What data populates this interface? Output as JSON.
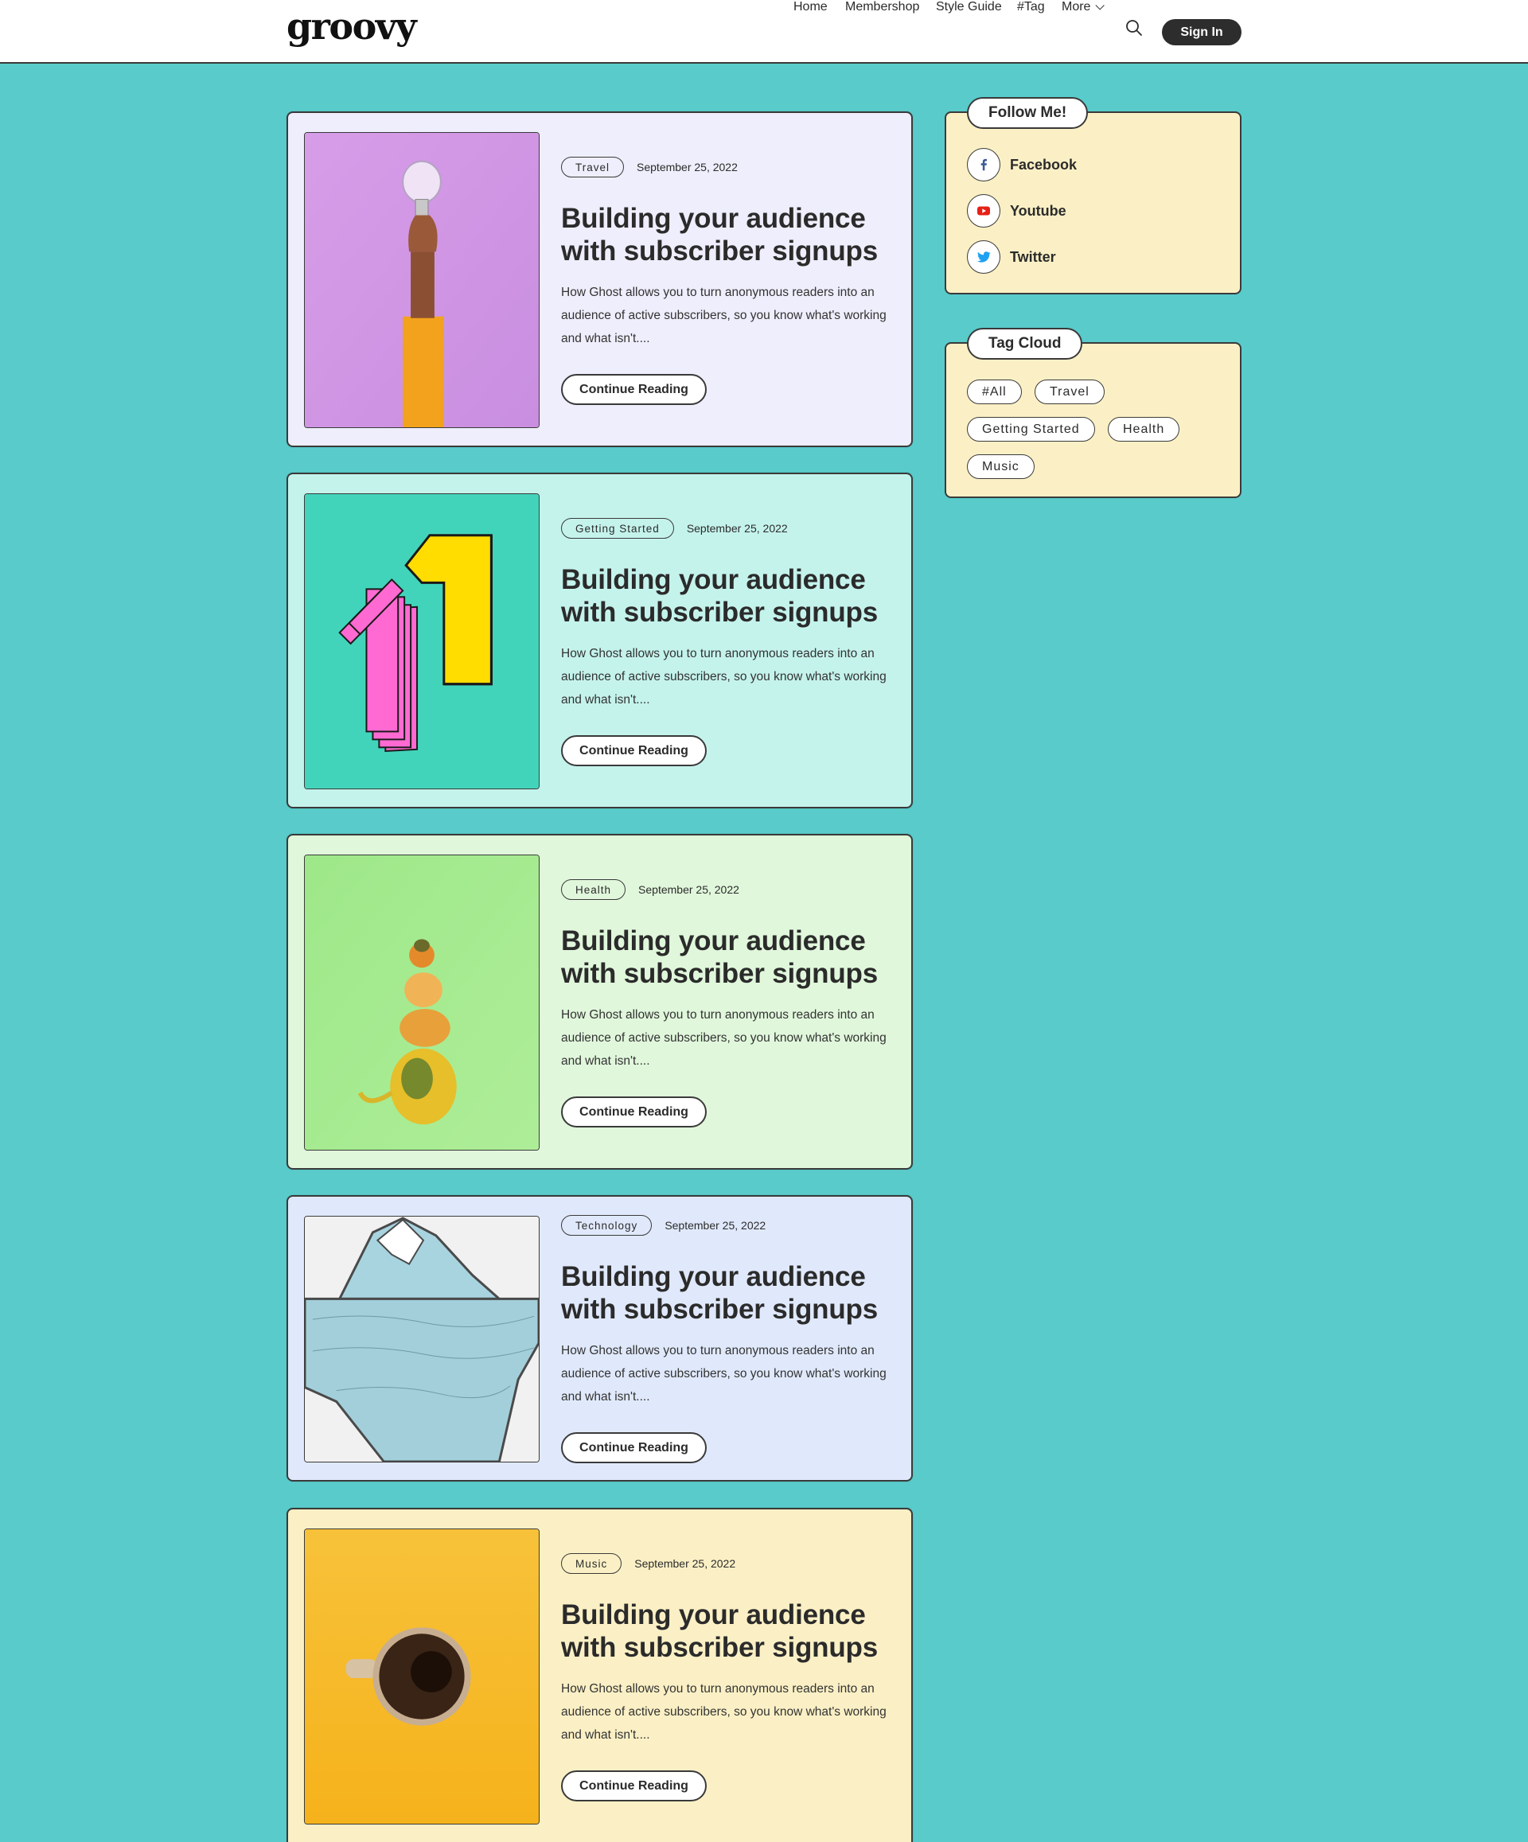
{
  "header": {
    "logo": "groovy",
    "nav": [
      {
        "label": "Home"
      },
      {
        "label": "Membershop"
      },
      {
        "label": "Style Guide"
      },
      {
        "label": "#Tag"
      },
      {
        "label": "More"
      }
    ],
    "search_icon": "search-icon",
    "signin_label": "Sign In"
  },
  "posts": [
    {
      "tag": "Travel",
      "date": "September 25, 2022",
      "title": "Building your audience with subscriber signups",
      "excerpt": "How Ghost allows you to turn anonymous readers into an audience of active subscribers, so you know what's working and what isn't....",
      "button": "Continue Reading",
      "bg": "#eeeefc",
      "image": "lightbulb-in-hand"
    },
    {
      "tag": "Getting Started",
      "date": "September 25, 2022",
      "title": "Building your audience with subscriber signups",
      "excerpt": "How Ghost allows you to turn anonymous readers into an audience of active subscribers, so you know what's working and what isn't....",
      "button": "Continue Reading",
      "bg": "#c4f3ec",
      "image": "number-one-illustration"
    },
    {
      "tag": "Health",
      "date": "September 25, 2022",
      "title": "Building your audience with subscriber signups",
      "excerpt": "How Ghost allows you to turn anonymous readers into an audience of active subscribers, so you know what's working and what isn't....",
      "button": "Continue Reading",
      "bg": "#e0f7db",
      "image": "stacked-gourds"
    },
    {
      "tag": "Technology",
      "date": "September 25, 2022",
      "title": "Building your audience with subscriber signups",
      "excerpt": "How Ghost allows you to turn anonymous readers into an audience of active subscribers, so you know what's working and what isn't....",
      "button": "Continue Reading",
      "bg": "#e0e9fb",
      "image": "iceberg-illustration"
    },
    {
      "tag": "Music",
      "date": "September 25, 2022",
      "title": "Building your audience with subscriber signups",
      "excerpt": "How Ghost allows you to turn anonymous readers into an audience of active subscribers, so you know what's working and what isn't....",
      "button": "Continue Reading",
      "bg": "#fbf0c5",
      "image": "coffee-cup"
    }
  ],
  "sidebar": {
    "follow": {
      "title": "Follow Me!",
      "items": [
        {
          "label": "Facebook",
          "icon": "facebook-icon",
          "color": "#3b5998"
        },
        {
          "label": "Youtube",
          "icon": "youtube-icon",
          "color": "#e62117"
        },
        {
          "label": "Twitter",
          "icon": "twitter-icon",
          "color": "#1da1f2"
        }
      ]
    },
    "tag_cloud": {
      "title": "Tag Cloud",
      "tags": [
        "#All",
        "Travel",
        "Getting Started",
        "Health",
        "Music"
      ]
    }
  },
  "colors": {
    "page_bg": "#58cbca",
    "widget_bg": "#fbf0c5",
    "border": "#3a3a3a"
  }
}
